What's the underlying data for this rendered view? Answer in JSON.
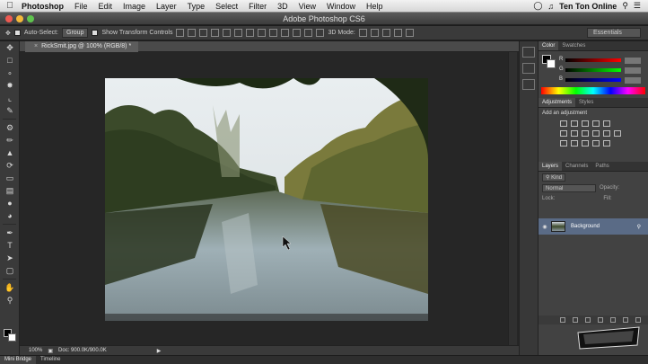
{
  "menubar": {
    "app_name": "Photoshop",
    "items": [
      "File",
      "Edit",
      "Image",
      "Layer",
      "Type",
      "Select",
      "Filter",
      "3D",
      "View",
      "Window",
      "Help"
    ],
    "user": "Ten Ton Online"
  },
  "window": {
    "title": "Adobe Photoshop CS6"
  },
  "options": {
    "auto_select_label": "Auto-Select:",
    "auto_select_value": "Group",
    "transform_label": "Show Transform Controls",
    "mode_3d_label": "3D Mode:",
    "workspace": "Essentials"
  },
  "document": {
    "tab_label": "RickSmit.jpg @ 100% (RGB/8) *",
    "zoom": "100%",
    "doc_info": "Doc: 900.0K/900.0K"
  },
  "bottom_tabs": [
    "Mini Bridge",
    "Timeline"
  ],
  "color_panel": {
    "tabs": [
      "Color",
      "Swatches"
    ],
    "channels": [
      "R",
      "G",
      "B"
    ]
  },
  "adjustments_panel": {
    "tabs": [
      "Adjustments",
      "Styles"
    ],
    "title": "Add an adjustment"
  },
  "layers_panel": {
    "tabs": [
      "Layers",
      "Channels",
      "Paths"
    ],
    "kind_label": "Kind",
    "blend_mode": "Normal",
    "opacity_label": "Opacity:",
    "lock_label": "Lock:",
    "fill_label": "Fill:",
    "layer_name": "Background"
  },
  "watermark_text": "TEN TON ONLINE.COM",
  "colors": {
    "accent_layer": "#5a6b86",
    "traffic_red": "#ee5a52",
    "traffic_yellow": "#f4b93a",
    "traffic_green": "#5fc44e"
  }
}
